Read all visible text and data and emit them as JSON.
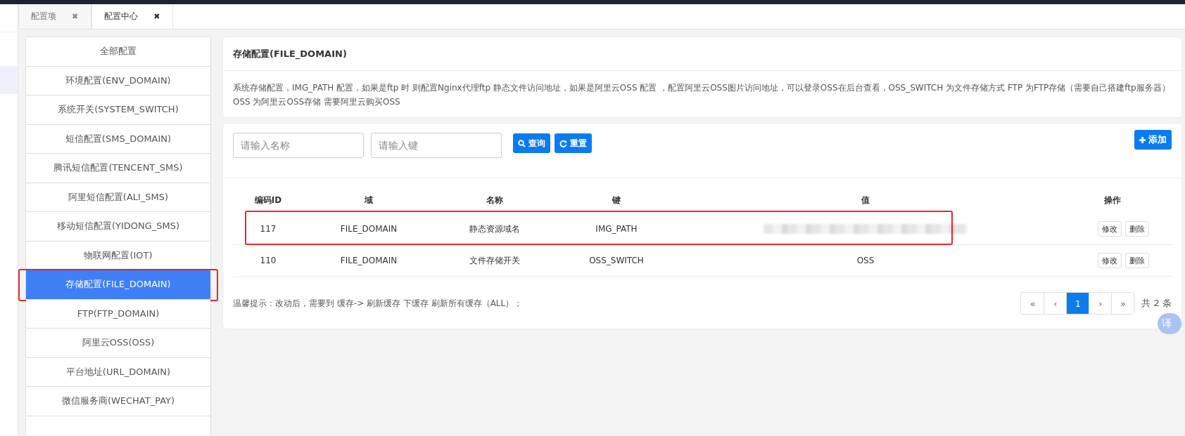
{
  "tabs": [
    {
      "label": "配置项",
      "close": "✖",
      "selected": false
    },
    {
      "label": "配置中心",
      "close": "✖",
      "selected": true
    }
  ],
  "sidebar": {
    "items": [
      {
        "label": "全部配置",
        "selected": false,
        "highlighted": false
      },
      {
        "label": "环境配置(ENV_DOMAIN)",
        "selected": false,
        "highlighted": false
      },
      {
        "label": "系统开关(SYSTEM_SWITCH)",
        "selected": false,
        "highlighted": false
      },
      {
        "label": "短信配置(SMS_DOMAIN)",
        "selected": false,
        "highlighted": false
      },
      {
        "label": "腾讯短信配置(TENCENT_SMS)",
        "selected": false,
        "highlighted": false
      },
      {
        "label": "阿里短信配置(ALI_SMS)",
        "selected": false,
        "highlighted": false
      },
      {
        "label": "移动短信配置(YIDONG_SMS)",
        "selected": false,
        "highlighted": false
      },
      {
        "label": "物联网配置(IOT)",
        "selected": false,
        "highlighted": false
      },
      {
        "label": "存储配置(FILE_DOMAIN)",
        "selected": true,
        "highlighted": true
      },
      {
        "label": "FTP(FTP_DOMAIN)",
        "selected": false,
        "highlighted": false
      },
      {
        "label": "阿里云OSS(OSS)",
        "selected": false,
        "highlighted": false
      },
      {
        "label": "平台地址(URL_DOMAIN)",
        "selected": false,
        "highlighted": false
      },
      {
        "label": "微信服务商(WECHAT_PAY)",
        "selected": false,
        "highlighted": false
      }
    ]
  },
  "info": {
    "title": "存储配置(FILE_DOMAIN)",
    "description": "系统存储配置，IMG_PATH 配置，如果是ftp 时 则配置Nginx代理ftp 静态文件访问地址，如果是阿里云OSS 配置 ，配置阿里云OSS图片访问地址，可以登录OSS在后台查看，OSS_SWITCH 为文件存储方式 FTP 为FTP存储（需要自己搭建ftp服务器） OSS 为阿里云OSS存储 需要阿里云购买OSS"
  },
  "search": {
    "name_placeholder": "请输入名称",
    "key_placeholder": "请输入键",
    "query": "查询",
    "reset": "重置",
    "add": "添加"
  },
  "table": {
    "columns": [
      "编码ID",
      "域",
      "名称",
      "键",
      "值",
      "操作"
    ],
    "rows": [
      {
        "id": "117",
        "domain": "FILE_DOMAIN",
        "name": "静态资源域名",
        "key": "IMG_PATH",
        "value_blurred": true,
        "value": "",
        "highlighted": true,
        "actions": [
          "修改",
          "删除"
        ]
      },
      {
        "id": "110",
        "domain": "FILE_DOMAIN",
        "name": "文件存储开关",
        "key": "OSS_SWITCH",
        "value_blurred": false,
        "value": "OSS",
        "highlighted": false,
        "actions": [
          "修改",
          "删除"
        ]
      }
    ]
  },
  "tip": "温馨提示：改动后，需要到 缓存-> 刷新缓存 下缓存 刷新所有缓存（ALL）；",
  "pagination": {
    "first": "«",
    "prev": "‹",
    "pages": [
      {
        "label": "1",
        "selected": true
      }
    ],
    "next": "›",
    "last": "»",
    "total": "共 2 条"
  },
  "translate": "译"
}
